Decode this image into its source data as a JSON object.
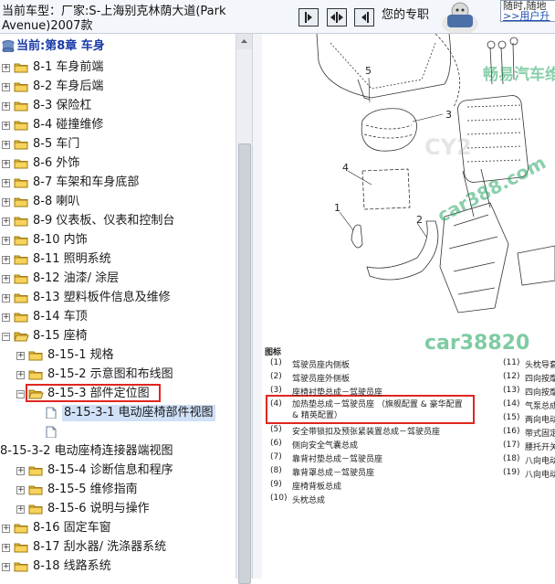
{
  "header": {
    "car_label": "当前车型：",
    "car_value": "厂家:S-上海别克林荫大道(Park Avenue)2007款",
    "tip_text": "您的专职",
    "user_box_line1": "随时,随地",
    "user_box_link": ">>用户升"
  },
  "nav_buttons": [
    {
      "name": "sync-tree-button",
      "icon": "arrow-right-icon"
    },
    {
      "name": "expand-collapse-button",
      "icon": "left-right-arrows-icon"
    },
    {
      "name": "previous-page-button",
      "icon": "arrow-left-icon"
    }
  ],
  "tree": {
    "root_label": "当前:第8章 车身",
    "items": [
      {
        "label": "8-1 车身前端",
        "level": 1,
        "state": "collapsed",
        "icon": "folder-icon"
      },
      {
        "label": "8-2 车身后端",
        "level": 1,
        "state": "collapsed",
        "icon": "folder-icon"
      },
      {
        "label": "8-3 保险杠",
        "level": 1,
        "state": "collapsed",
        "icon": "folder-icon"
      },
      {
        "label": "8-4 碰撞维修",
        "level": 1,
        "state": "collapsed",
        "icon": "folder-icon"
      },
      {
        "label": "8-5 车门",
        "level": 1,
        "state": "collapsed",
        "icon": "folder-icon"
      },
      {
        "label": "8-6 外饰",
        "level": 1,
        "state": "collapsed",
        "icon": "folder-icon"
      },
      {
        "label": "8-7 车架和车身底部",
        "level": 1,
        "state": "collapsed",
        "icon": "folder-icon"
      },
      {
        "label": "8-8 喇叭",
        "level": 1,
        "state": "collapsed",
        "icon": "folder-icon"
      },
      {
        "label": "8-9 仪表板、仪表和控制台",
        "level": 1,
        "state": "collapsed",
        "icon": "folder-icon"
      },
      {
        "label": "8-10 内饰",
        "level": 1,
        "state": "collapsed",
        "icon": "folder-icon"
      },
      {
        "label": "8-11 照明系统",
        "level": 1,
        "state": "collapsed",
        "icon": "folder-icon"
      },
      {
        "label": "8-12 油漆/ 涂层",
        "level": 1,
        "state": "collapsed",
        "icon": "folder-icon"
      },
      {
        "label": "8-13 塑料板件信息及维修",
        "level": 1,
        "state": "collapsed",
        "icon": "folder-icon"
      },
      {
        "label": "8-14 车顶",
        "level": 1,
        "state": "collapsed",
        "icon": "folder-icon"
      },
      {
        "label": "8-15 座椅",
        "level": 1,
        "state": "expanded",
        "icon": "folder-open-icon"
      },
      {
        "label": "8-15-1 规格",
        "level": 2,
        "state": "collapsed",
        "icon": "folder-icon"
      },
      {
        "label": "8-15-2 示意图和布线图",
        "level": 2,
        "state": "collapsed",
        "icon": "folder-icon"
      },
      {
        "label": "8-15-3 部件定位图",
        "level": 2,
        "state": "expanded",
        "icon": "folder-open-icon",
        "highlight": true
      },
      {
        "label": "8-15-3-1 电动座椅部件视图",
        "level": 3,
        "state": "leaf",
        "icon": "document-icon",
        "selected": true
      },
      {
        "label": "",
        "level": 3,
        "state": "leaf",
        "icon": "document-icon"
      },
      {
        "label": "8-15-3-2 电动座椅连接器端视图",
        "level": 0,
        "state": "none",
        "icon": ""
      },
      {
        "label": "8-15-4 诊断信息和程序",
        "level": 2,
        "state": "collapsed",
        "icon": "folder-icon"
      },
      {
        "label": "8-15-5 维修指南",
        "level": 2,
        "state": "collapsed",
        "icon": "folder-icon"
      },
      {
        "label": "8-15-6 说明与操作",
        "level": 2,
        "state": "collapsed",
        "icon": "folder-icon"
      },
      {
        "label": "8-16 固定车窗",
        "level": 1,
        "state": "collapsed",
        "icon": "folder-icon"
      },
      {
        "label": "8-17 刮水器/ 洗涤器系统",
        "level": 1,
        "state": "collapsed",
        "icon": "folder-icon"
      },
      {
        "label": "8-18 线路系统",
        "level": 1,
        "state": "collapsed",
        "icon": "folder-icon"
      }
    ]
  },
  "document": {
    "callouts": [
      "5",
      "3",
      "4",
      "1",
      "2"
    ],
    "legend_title": "图标",
    "legend_left": [
      {
        "num": "(1)",
        "text": "驾驶员座内侧板"
      },
      {
        "num": "(2)",
        "text": "驾驶员座外侧板"
      },
      {
        "num": "(3)",
        "text": "座椅衬垫总成－驾驶员座"
      },
      {
        "num": "(4)",
        "text": "加热垫总成－驾驶员座 （旗舰配置 & 豪华配置 & 精英配置）",
        "highlight": true
      },
      {
        "num": "(5)",
        "text": "安全带锁扣及预张紧装置总成－驾驶员座"
      },
      {
        "num": "(6)",
        "text": "侧向安全气囊总成"
      },
      {
        "num": "(7)",
        "text": "靠背衬垫总成－驾驶员座"
      },
      {
        "num": "(8)",
        "text": "靠背罩总成－驾驶员座"
      },
      {
        "num": "(9)",
        "text": "座椅背板总成"
      },
      {
        "num": "(10)",
        "text": "头枕总成"
      }
    ],
    "legend_right": [
      {
        "num": "(11)",
        "text": "头枕导套"
      },
      {
        "num": "(12)",
        "text": "四向按摩"
      },
      {
        "num": "(13)",
        "text": "四向按摩"
      },
      {
        "num": "(14)",
        "text": "气泵总成"
      },
      {
        "num": "(15)",
        "text": "两向电动适配置)"
      },
      {
        "num": "(16)",
        "text": "带式固定"
      },
      {
        "num": "(17)",
        "text": "腰托开关"
      },
      {
        "num": "(18)",
        "text": "八向电动"
      },
      {
        "num": "(19)",
        "text": "八向电动"
      }
    ],
    "watermarks": [
      "畅易汽车维",
      "CY2",
      "car388.com",
      "car38820"
    ]
  },
  "colors": {
    "highlight_box": "#e0261f",
    "watermark_green": "#2aa866",
    "selection": "#cfe0f7",
    "folder": "#f0c43f"
  }
}
